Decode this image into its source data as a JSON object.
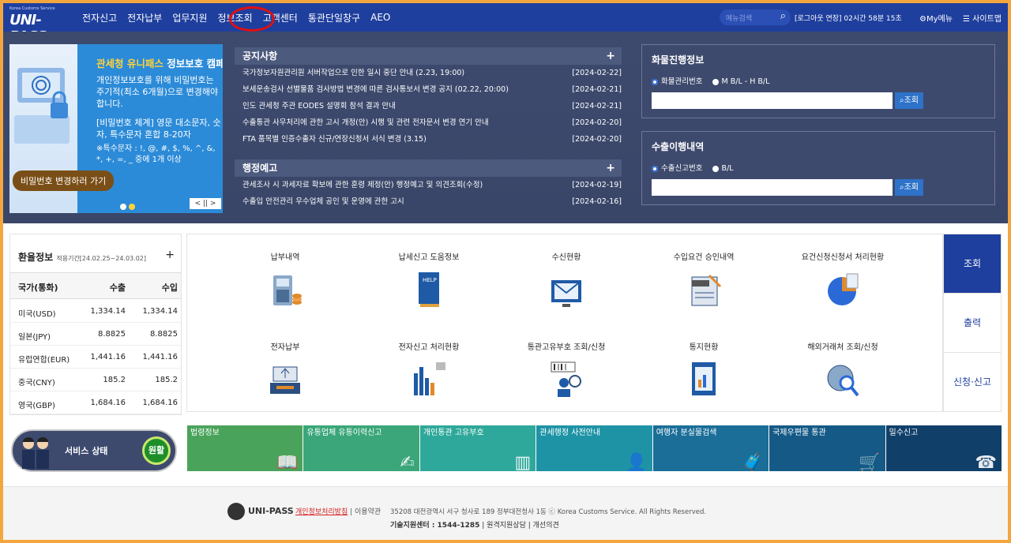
{
  "header": {
    "logo_small": "Korea Customs Service",
    "logo": "UNI-PASS",
    "nav": [
      "전자신고",
      "전자납부",
      "업무지원",
      "정보조회",
      "고객센터",
      "통관단일창구",
      "AEO"
    ],
    "search_placeholder": "메뉴검색",
    "session": "[로그아웃 연장] 02시간 58분 15초",
    "my_menu": "My메뉴",
    "sitemap": "사이트맵"
  },
  "banner": {
    "title_yellow": "관세청 유니패스",
    "title_white": "정보보호 캠페인",
    "para1": "개인정보보호를 위해 비밀번호는 주기적(최소 6개월)으로 변경해야 합니다.",
    "para2": "[비밀번호 체계] 영문 대소문자, 숫자, 특수문자 혼합 8-20자",
    "para3": "※특수문자 : !, @, #, $, %, ^, &, *, +, =, _ 중에 1개 이상",
    "button": "비밀번호 변경하러 가기",
    "control": "< || >"
  },
  "notice": {
    "title": "공지사항",
    "items": [
      {
        "text": "국가정보자원관리원 서버작업으로 인한 일시 중단 안내 (2.23, 19:00)",
        "date": "[2024-02-22]"
      },
      {
        "text": "보세운송검사 선별물품 검사방법 변경에 따른 검사통보서 변경 공지 (02.22, 20:00)",
        "date": "[2024-02-21]"
      },
      {
        "text": "인도 관세청 주관 EODES 설명회 참석 결과 안내",
        "date": "[2024-02-21]"
      },
      {
        "text": "수출통관 사무처리에 관한 고시 개정(안) 시행 및 관련 전자문서 변경 연기 안내",
        "date": "[2024-02-20]"
      },
      {
        "text": "FTA 품목별 인증수출자 신규/연장신청서 서식 변경 (3.15)",
        "date": "[2024-02-20]"
      }
    ]
  },
  "admin_notice": {
    "title": "행정예고",
    "items": [
      {
        "text": "관세조사 시 과세자료 확보에 관한 훈령 제정(안) 행정예고 및 의견조회(수정)",
        "date": "[2024-02-19]"
      },
      {
        "text": "수출입 안전관리 우수업체 공인 및 운영에 관한 고시",
        "date": "[2024-02-16]"
      }
    ]
  },
  "cargo": {
    "title": "화물진행정보",
    "opt1": "화물관리번호",
    "opt2": "M B/L - H B/L",
    "button": "조회"
  },
  "export": {
    "title": "수출이행내역",
    "opt1": "수출신고번호",
    "opt2": "B/L",
    "button": "조회"
  },
  "exchange": {
    "title": "환율정보",
    "period": "적용기간[24.02.25~24.03.02]",
    "headers": [
      "국가(통화)",
      "수출",
      "수입"
    ],
    "rows": [
      [
        "미국(USD)",
        "1,334.14",
        "1,334.14"
      ],
      [
        "일본(JPY)",
        "8.8825",
        "8.8825"
      ],
      [
        "유럽연합(EUR)",
        "1,441.16",
        "1,441.16"
      ],
      [
        "중국(CNY)",
        "185.2",
        "185.2"
      ],
      [
        "영국(GBP)",
        "1,684.16",
        "1,684.16"
      ]
    ]
  },
  "services": [
    {
      "label": "납부내역"
    },
    {
      "label": "납세신고 도움정보"
    },
    {
      "label": "수신현황"
    },
    {
      "label": "수입요건 승인내역"
    },
    {
      "label": "요건신청신청서 처리현황"
    },
    {
      "label": "전자납부"
    },
    {
      "label": "전자신고 처리현황"
    },
    {
      "label": "통관고유부호 조회/신청"
    },
    {
      "label": "통지현황"
    },
    {
      "label": "해외거래처 조회/신청"
    }
  ],
  "side_tabs": [
    "조회",
    "출력",
    "신청·신고"
  ],
  "status": {
    "label": "서비스 상태",
    "state": "원활"
  },
  "tiles": [
    {
      "label": "법령정보",
      "color": "#4aa35a"
    },
    {
      "label": "유통업체 유통이력신고",
      "color": "#3aa67a"
    },
    {
      "label": "개인통관 고유부호",
      "color": "#2ea89a"
    },
    {
      "label": "관세행정 사전안내",
      "color": "#1f93a6"
    },
    {
      "label": "여행자 분실물검색",
      "color": "#1a6e98"
    },
    {
      "label": "국제우편물 통관",
      "color": "#155a86"
    },
    {
      "label": "밀수신고",
      "color": "#103f6a"
    }
  ],
  "footer": {
    "name": "UNI-PASS",
    "privacy": "개인정보처리방침",
    "terms": "이용약관",
    "address": "35208 대전광역시 서구 청사로 189 정부대전청사 1동 ⓒ Korea Customs Service. All Rights Reserved.",
    "helpdesk_label": "기술지원센터 : 1544-1285",
    "remote": "원격지원상담",
    "feedback": "개선의견"
  }
}
